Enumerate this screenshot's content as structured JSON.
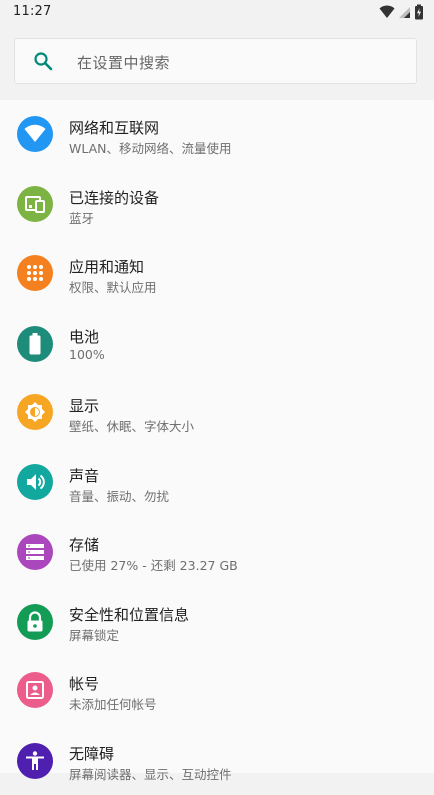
{
  "status_bar": {
    "time": "11:27"
  },
  "search": {
    "placeholder": "在设置中搜索",
    "accent_color": "#00897b"
  },
  "settings": [
    {
      "title": "网络和互联网",
      "subtitle": "WLAN、移动网络、流量使用",
      "icon": "wifi-icon",
      "color": "#2196f3"
    },
    {
      "title": "已连接的设备",
      "subtitle": "蓝牙",
      "icon": "devices-icon",
      "color": "#7cb342"
    },
    {
      "title": "应用和通知",
      "subtitle": "权限、默认应用",
      "icon": "apps-icon",
      "color": "#f4801f"
    },
    {
      "title": "电池",
      "subtitle": "100%",
      "icon": "battery-icon",
      "color": "#1e8c7a"
    },
    {
      "title": "显示",
      "subtitle": "壁纸、休眠、字体大小",
      "icon": "brightness-icon",
      "color": "#f6a623"
    },
    {
      "title": "声音",
      "subtitle": "音量、振动、勿扰",
      "icon": "volume-icon",
      "color": "#12a8a0"
    },
    {
      "title": "存储",
      "subtitle": "已使用 27% - 还剩 23.27 GB",
      "icon": "storage-icon",
      "color": "#ab47bc"
    },
    {
      "title": "安全性和位置信息",
      "subtitle": "屏幕锁定",
      "icon": "lock-icon",
      "color": "#139c55"
    },
    {
      "title": "帐号",
      "subtitle": "未添加任何帐号",
      "icon": "account-icon",
      "color": "#ec5d8c"
    },
    {
      "title": "无障碍",
      "subtitle": "屏幕阅读器、显示、互动控件",
      "icon": "accessibility-icon",
      "color": "#4f1fb0"
    }
  ]
}
